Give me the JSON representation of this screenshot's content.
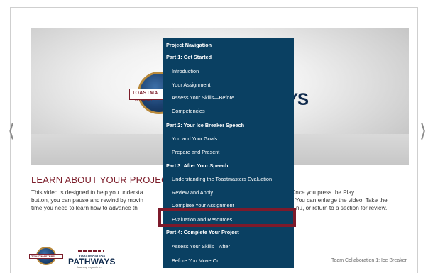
{
  "nav_arrows": {
    "prev": "⟨",
    "next": "⟩"
  },
  "video": {
    "logo_ring_text": "TOASTMA",
    "logo_ring_sub": "INTERNAT",
    "logo_word": "YS"
  },
  "learn": {
    "title": "LEARN ABOUT YOUR PROJECT",
    "body_lines": [
      {
        "left": "This video is designed to help you understa",
        "right": "ojects. Once you press the Play"
      },
      {
        "left": "button, you can pause and rewind by movin",
        "right": "You can enlarge the video. Take the"
      },
      {
        "left": "time you need to learn how to advance th",
        "right": "nu, or return to a section for review."
      }
    ]
  },
  "footer": {
    "tm_logo_text": "TOASTMASTERS",
    "pathways_top": "TOASTMASTERS",
    "pathways_word": "PATHWAYS",
    "pathways_sub": "learning experience",
    "project_label": "Team Collaboration 1: Ice Breaker"
  },
  "project_nav": {
    "title": "Project Navigation",
    "sections": [
      {
        "heading": "Part 1: Get Started",
        "items": [
          "Introduction",
          "Your Assignment",
          "Assess Your Skills—Before",
          "Competencies"
        ]
      },
      {
        "heading": "Part 2: Your Ice Breaker Speech",
        "items": [
          "You and Your Goals",
          "Prepare and Present"
        ]
      },
      {
        "heading": "Part 3: After Your Speech",
        "items": [
          "Understanding the Toastmasters Evaluation",
          "Review and Apply",
          "Complete Your Assignment",
          "Evaluation and Resources"
        ]
      },
      {
        "heading": "Part 4: Complete Your Project",
        "items": [
          "Assess Your Skills—After",
          "Before You Move On"
        ]
      }
    ],
    "highlighted_item": "Evaluation and Resources"
  },
  "colors": {
    "panel_bg": "#0a4062",
    "highlight_border": "#7d1a2b",
    "title_accent": "#7c1d2a"
  }
}
